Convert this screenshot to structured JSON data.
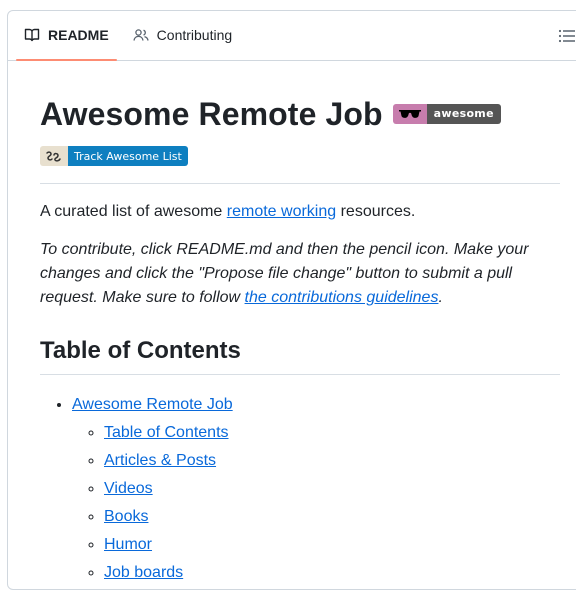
{
  "tabs": [
    {
      "label": "README",
      "icon": "book-icon",
      "active": true
    },
    {
      "label": "Contributing",
      "icon": "people-icon",
      "active": false
    }
  ],
  "title": "Awesome Remote Job",
  "awesome_badge": {
    "icon": "sunglasses-icon",
    "text": "awesome",
    "left_color": "#c77dad",
    "right_color": "#555555"
  },
  "track_badge": {
    "icon": "track-awesome-icon",
    "text": "Track Awesome List",
    "right_color": "#0e7fc0"
  },
  "intro": {
    "before": "A curated list of awesome ",
    "link": "remote working",
    "after": " resources."
  },
  "note": {
    "before": "To contribute, click README.md and then the pencil icon. Make your changes and click the \"Propose file change\" button to submit a pull request. Make sure to follow ",
    "link": "the contributions guidelines",
    "after": "."
  },
  "toc_heading": "Table of Contents",
  "toc": {
    "top": "Awesome Remote Job",
    "items": [
      "Table of Contents",
      "Articles & Posts",
      "Videos",
      "Books",
      "Humor",
      "Job boards"
    ]
  },
  "colors": {
    "link": "#0969da",
    "active_tab_underline": "#fd8c73"
  }
}
